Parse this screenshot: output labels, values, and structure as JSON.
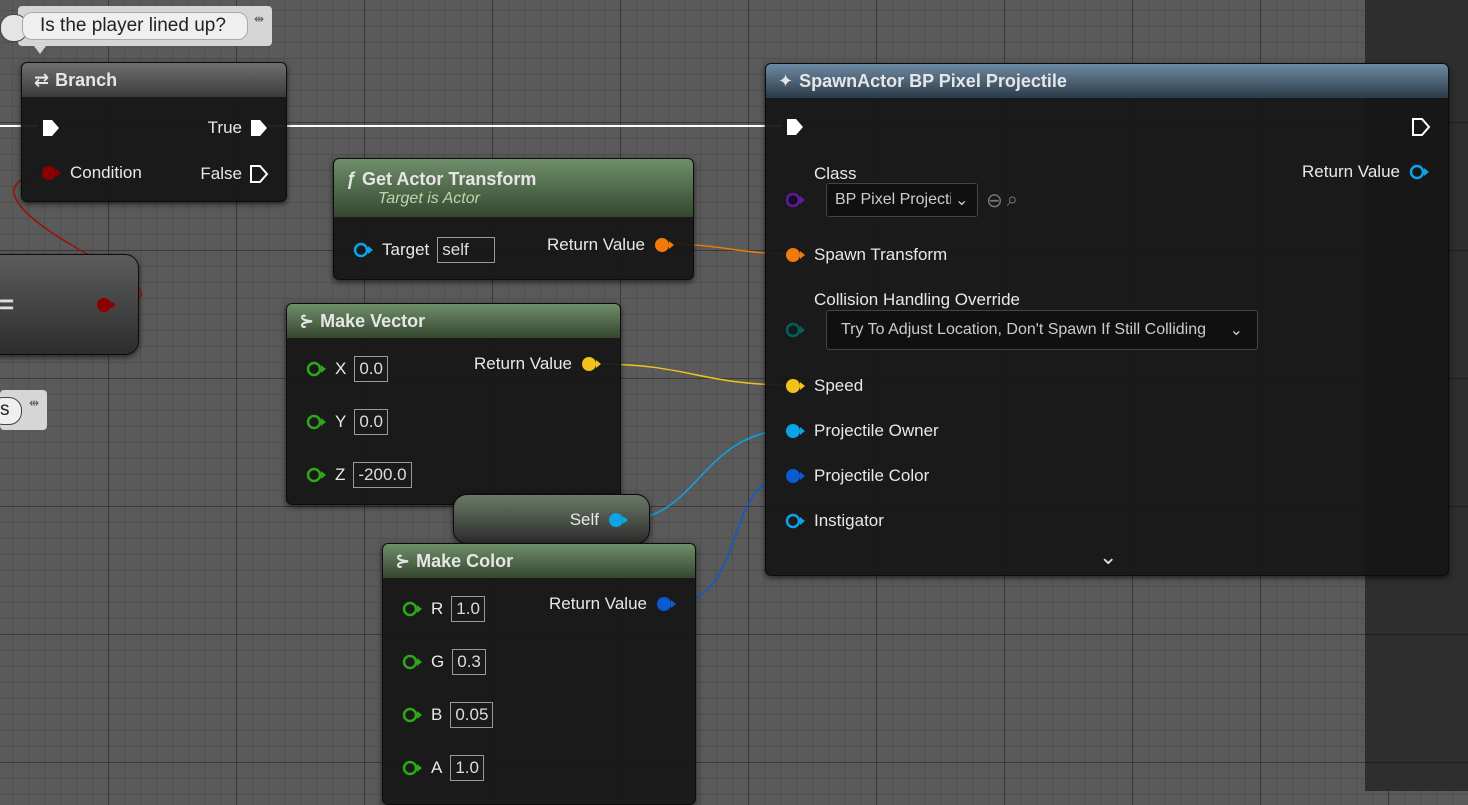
{
  "comment_top": {
    "text": "Is the player lined up?"
  },
  "comment_left": {
    "text": "s"
  },
  "branch": {
    "title": "Branch",
    "true_label": "True",
    "condition_label": "Condition",
    "false_label": "False"
  },
  "compare_node": {
    "symbol": "="
  },
  "get_actor_transform": {
    "title": "Get Actor Transform",
    "subtitle": "Target is Actor",
    "target_label": "Target",
    "target_value": "self",
    "return_label": "Return Value"
  },
  "make_vector": {
    "title": "Make Vector",
    "return_label": "Return Value",
    "inputs": [
      {
        "label": "X",
        "value": "0.0"
      },
      {
        "label": "Y",
        "value": "0.0"
      },
      {
        "label": "Z",
        "value": "-200.0"
      }
    ]
  },
  "self_node": {
    "label": "Self"
  },
  "make_color": {
    "title": "Make Color",
    "return_label": "Return Value",
    "inputs": [
      {
        "label": "R",
        "value": "1.0"
      },
      {
        "label": "G",
        "value": "0.3"
      },
      {
        "label": "B",
        "value": "0.05"
      },
      {
        "label": "A",
        "value": "1.0"
      }
    ]
  },
  "spawn_actor": {
    "title": "SpawnActor BP Pixel Projectile",
    "class_label": "Class",
    "class_value": "BP Pixel Projecti",
    "return_label": "Return Value",
    "spawn_transform_label": "Spawn Transform",
    "collision_label": "Collision Handling Override",
    "collision_value": "Try To Adjust Location, Don't Spawn If Still Colliding",
    "speed_label": "Speed",
    "owner_label": "Projectile Owner",
    "color_label": "Projectile Color",
    "instigator_label": "Instigator"
  },
  "colors": {
    "exec": "#ffffff",
    "bool": "#8b0000",
    "object": "#0aa5e6",
    "transform": "#f07b0a",
    "vector": "#f2c21b",
    "linear_color": "#0a5ad2",
    "float": "#2ea81a",
    "class": "#5a1e96",
    "enum": "#0a5e5a"
  }
}
